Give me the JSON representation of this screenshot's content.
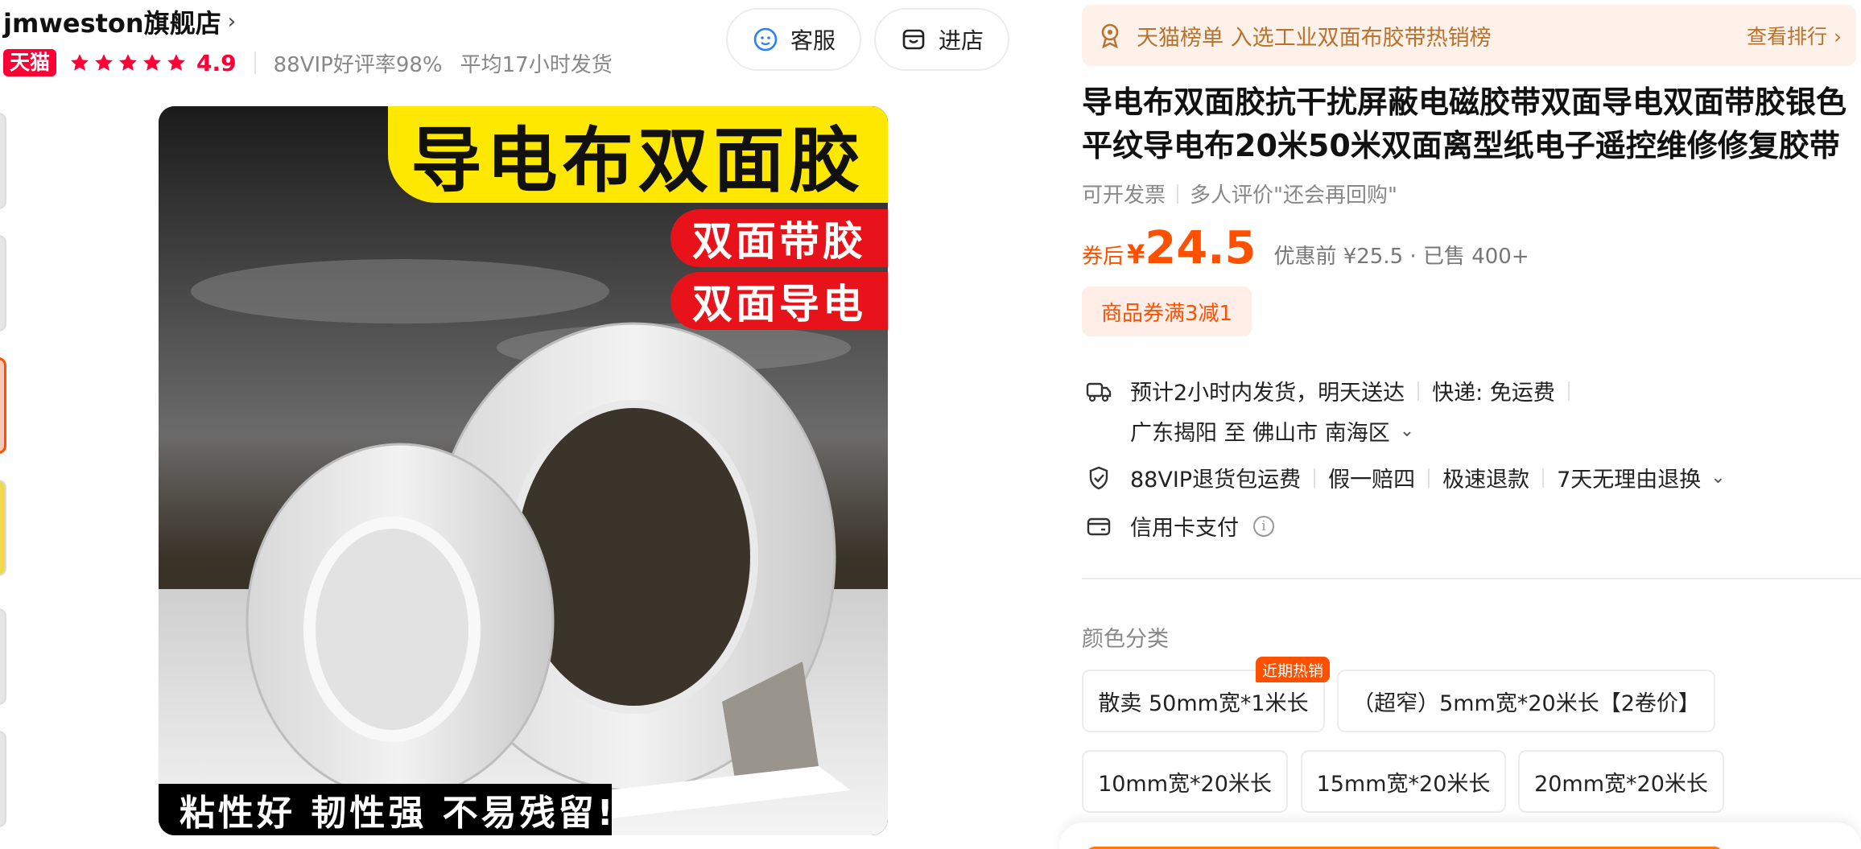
{
  "shop": {
    "name": "jmweston旗舰店",
    "chevron": "›",
    "badge": "天猫",
    "rating": "4.9",
    "stats": [
      "88VIP好评率98%",
      "平均17小时发货"
    ]
  },
  "header_buttons": {
    "service": "客服",
    "store": "进店"
  },
  "image": {
    "headline": "导电布双面胶",
    "tag1": "双面带胶",
    "tag2": "双面导电",
    "bottom": "粘性好 韧性强 不易残留!"
  },
  "rank": {
    "text": "天猫榜单 入选工业双面布胶带热销榜",
    "link": "查看排行 ›"
  },
  "product": {
    "title": "导电布双面胶抗干扰屏蔽电磁胶带双面导电双面带胶银色平纹导电布20米50米双面离型纸电子遥控维修修复胶带",
    "invoice": "可开发票",
    "review": "多人评价\"还会再回购\""
  },
  "price": {
    "prefix": "券后",
    "currency": "¥",
    "value": "24.5",
    "note": "优惠前 ¥25.5 · 已售 400+"
  },
  "coupon": "商品券满3减1",
  "delivery": {
    "eta": "预计2小时内发货，明天送达",
    "shipping": "快递: 免运费",
    "location": "广东揭阳 至 佛山市 南海区"
  },
  "services": [
    "88VIP退货包运费",
    "假一赔四",
    "极速退款",
    "7天无理由退换"
  ],
  "payment": {
    "label": "信用卡支付",
    "info": "i"
  },
  "sku": {
    "label": "颜色分类",
    "hot_tag": "近期热销",
    "options": [
      "散卖 50mm宽*1米长",
      "（超窄）5mm宽*20米长【2卷价】",
      "10mm宽*20米长",
      "15mm宽*20米长",
      "20mm宽*20米长"
    ]
  },
  "colors": {
    "accent": "#ff5000",
    "tmall_red": "#ff0036",
    "rank_gold": "#b8722d",
    "headline_yellow": "#ffe800",
    "tag_red": "#e8131a"
  },
  "icons": {
    "service": "customer-service-icon",
    "store": "store-icon",
    "rank": "award-medal-icon",
    "delivery": "truck-icon",
    "service_guarantee": "shield-hand-icon",
    "payment": "credit-card-icon"
  }
}
